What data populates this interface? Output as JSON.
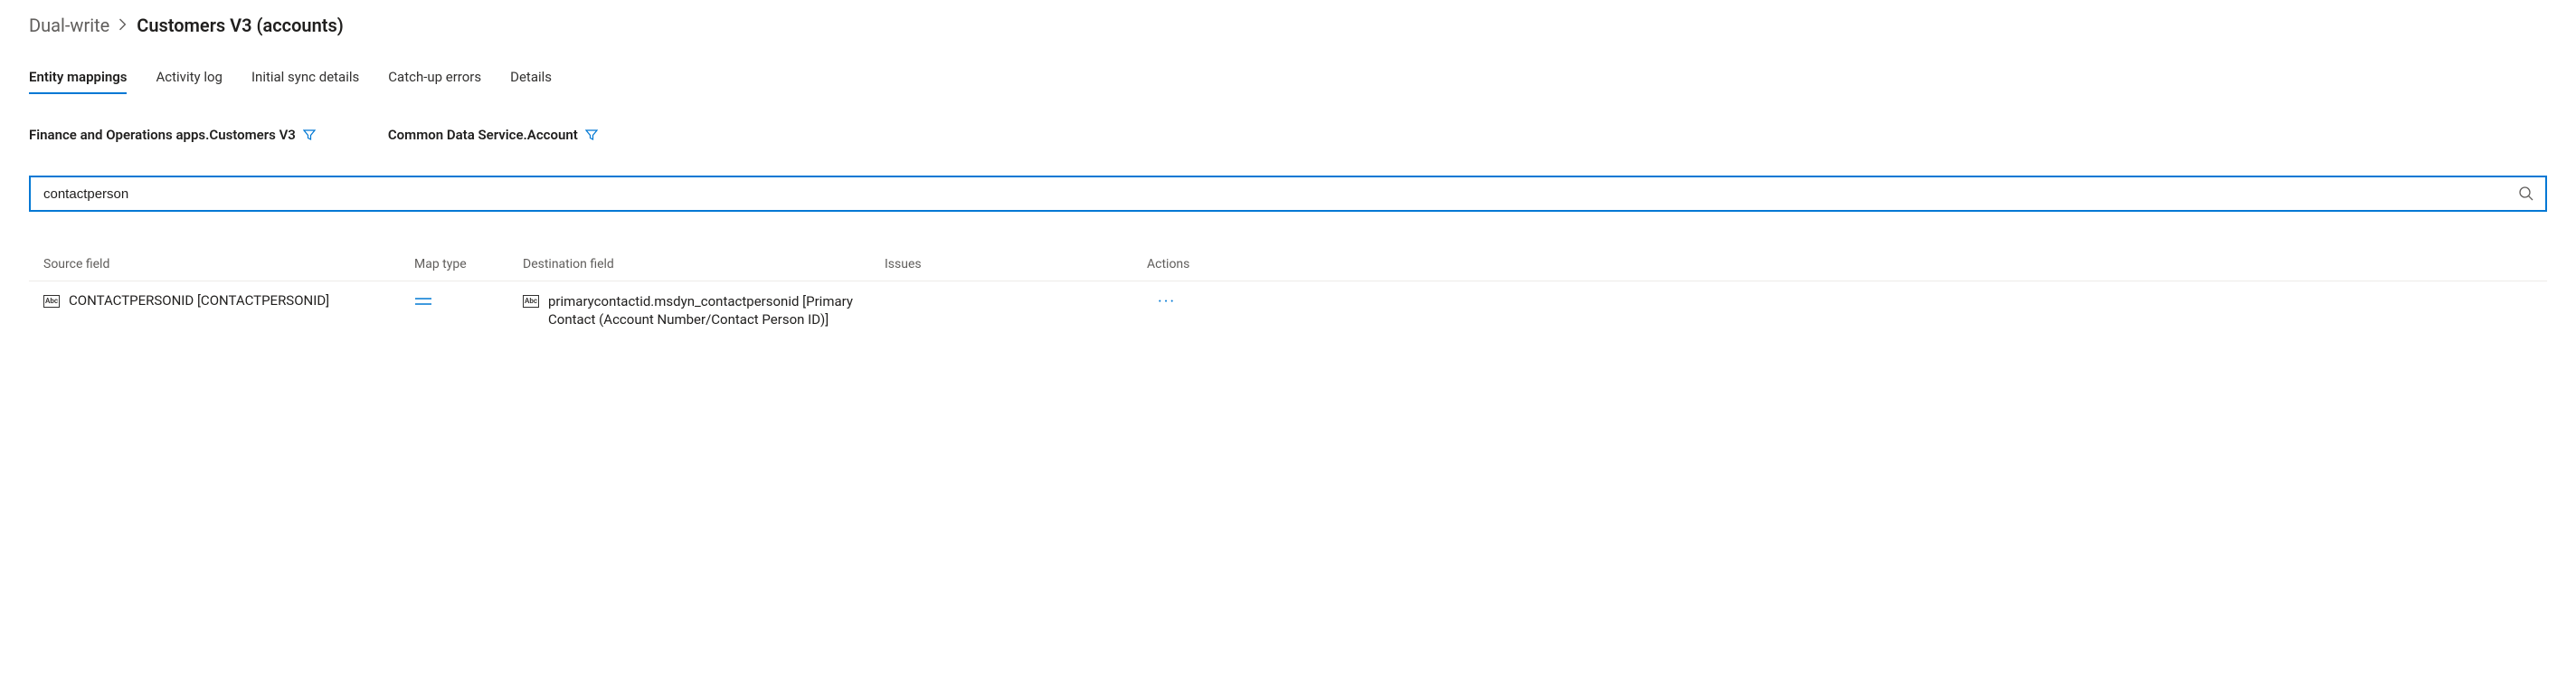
{
  "breadcrumb": {
    "parent": "Dual-write",
    "current": "Customers V3 (accounts)"
  },
  "tabs": [
    {
      "label": "Entity mappings",
      "active": true
    },
    {
      "label": "Activity log",
      "active": false
    },
    {
      "label": "Initial sync details",
      "active": false
    },
    {
      "label": "Catch-up errors",
      "active": false
    },
    {
      "label": "Details",
      "active": false
    }
  ],
  "entities": {
    "source": "Finance and Operations apps.Customers V3",
    "destination": "Common Data Service.Account"
  },
  "search": {
    "value": "contactperson"
  },
  "table": {
    "headers": {
      "source": "Source field",
      "maptype": "Map type",
      "destination": "Destination field",
      "issues": "Issues",
      "actions": "Actions"
    },
    "rows": [
      {
        "source": "CONTACTPERSONID [CONTACTPERSONID]",
        "maptype": "=",
        "destination": "primarycontactid.msdyn_contactpersonid [Primary Contact (Account Number/Contact Person ID)]",
        "issues": "",
        "actions": "..."
      }
    ]
  }
}
